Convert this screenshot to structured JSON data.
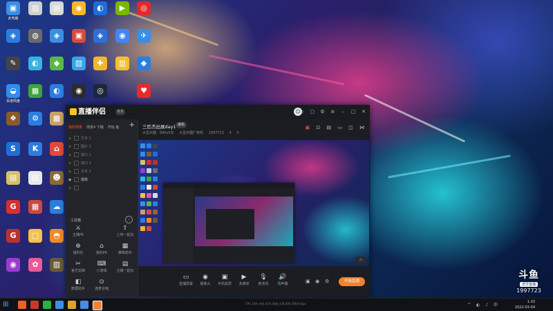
{
  "desktop": {
    "icons": [
      {
        "id": "d01",
        "label": "此电脑",
        "color": "#3a8ee6",
        "glyph": "▣"
      },
      {
        "id": "d02",
        "label": "",
        "color": "#2b7de0",
        "glyph": "◈"
      },
      {
        "id": "d03",
        "label": "",
        "color": "#444",
        "glyph": "✎"
      },
      {
        "id": "d04",
        "label": "百度网盘",
        "color": "#2f8cf0",
        "glyph": "◒"
      },
      {
        "id": "d05",
        "label": "",
        "color": "#8a5a2a",
        "glyph": "❖"
      },
      {
        "id": "d06",
        "label": "",
        "color": "#1d6fd8",
        "glyph": "S"
      },
      {
        "id": "d07",
        "label": "",
        "color": "#d8c06a",
        "glyph": "▤"
      },
      {
        "id": "d08",
        "label": "",
        "color": "#d92e2e",
        "glyph": "G"
      },
      {
        "id": "d09",
        "label": "",
        "color": "#b8322e",
        "glyph": "G"
      },
      {
        "id": "d10",
        "label": "",
        "color": "#9b3bd1",
        "glyph": "◉"
      },
      {
        "id": "d11",
        "label": "",
        "color": "#cfcfcf",
        "glyph": "▥"
      },
      {
        "id": "d12",
        "label": "",
        "color": "#6a6a6a",
        "glyph": "◍"
      },
      {
        "id": "d13",
        "label": "",
        "color": "#33b3e6",
        "glyph": "◐"
      },
      {
        "id": "d14",
        "label": "",
        "color": "#3ca33c",
        "glyph": "▦"
      },
      {
        "id": "d15",
        "label": "",
        "color": "#2d7de0",
        "glyph": "⚙"
      },
      {
        "id": "d16",
        "label": "",
        "color": "#2d7de0",
        "glyph": "K"
      },
      {
        "id": "d17",
        "label": "",
        "color": "#e8e8e8",
        "glyph": "▤"
      },
      {
        "id": "d18",
        "label": "",
        "color": "#c94a3a",
        "glyph": "▦"
      },
      {
        "id": "d19",
        "label": "",
        "color": "#f2c14e",
        "glyph": "▢"
      },
      {
        "id": "d20",
        "label": "",
        "color": "#e85a9a",
        "glyph": "✿"
      },
      {
        "id": "d21",
        "label": "",
        "color": "#d9d9d9",
        "glyph": "▤"
      },
      {
        "id": "d22",
        "label": "",
        "color": "#3a8ee6",
        "glyph": "◈"
      },
      {
        "id": "d23",
        "label": "",
        "color": "#58b948",
        "glyph": "◆"
      },
      {
        "id": "d24",
        "label": "",
        "color": "#2b7de0",
        "glyph": "◐"
      },
      {
        "id": "d25",
        "label": "",
        "color": "#c9a16a",
        "glyph": "▦"
      },
      {
        "id": "d26",
        "label": "",
        "color": "#e04a3a",
        "glyph": "⌂"
      },
      {
        "id": "d27",
        "label": "",
        "color": "#8a6a3a",
        "glyph": "☻"
      },
      {
        "id": "d28",
        "label": "",
        "color": "#2b7de0",
        "glyph": "☁"
      },
      {
        "id": "d29",
        "label": "",
        "color": "#f08a2a",
        "glyph": "◓"
      },
      {
        "id": "d30",
        "label": "",
        "color": "#6a5a3a",
        "glyph": "▥"
      },
      {
        "id": "d31",
        "label": "",
        "color": "#f2b72a",
        "glyph": "◉"
      },
      {
        "id": "d32",
        "label": "",
        "color": "#d84a3a",
        "glyph": "▣"
      },
      {
        "id": "d33",
        "label": "",
        "color": "#3aa3e6",
        "glyph": "▥"
      },
      {
        "id": "d34",
        "label": "",
        "color": "#2b2b2b",
        "glyph": "◉"
      },
      {
        "id": "d35",
        "label": "",
        "color": "#1d6fd8",
        "glyph": "◐"
      },
      {
        "id": "d36",
        "label": "",
        "color": "#2d6fd8",
        "glyph": "◈"
      },
      {
        "id": "d37",
        "label": "",
        "color": "#f2b72a",
        "glyph": "✚"
      },
      {
        "id": "d38",
        "label": "",
        "color": "#1b2838",
        "glyph": "◎"
      },
      {
        "id": "d39",
        "label": "",
        "color": "#76b900",
        "glyph": "▶"
      },
      {
        "id": "d40",
        "label": "",
        "color": "#4285f4",
        "glyph": "◉"
      },
      {
        "id": "d41",
        "label": "",
        "color": "#f2c12e",
        "glyph": "▥"
      },
      {
        "id": "d42",
        "label": "",
        "color": "#e02a2a",
        "glyph": "◎"
      },
      {
        "id": "d43",
        "label": "",
        "color": "#3a8ee6",
        "glyph": "✈"
      },
      {
        "id": "d44",
        "label": "",
        "color": "#2b7de0",
        "glyph": "◆"
      },
      {
        "id": "d45",
        "label": "",
        "color": "#e82a2a",
        "glyph": "♥"
      }
    ]
  },
  "app": {
    "logo_text": "直播伴侣",
    "version": "6.0",
    "sidebar": {
      "tabs": [
        "我的场景",
        "场景4 下播",
        "开始 备"
      ],
      "scenes": [
        {
          "label": "文本 1",
          "on": false
        },
        {
          "label": "图片 1",
          "on": false
        },
        {
          "label": "窗口 1",
          "on": false
        },
        {
          "label": "窗口 2",
          "on": false
        },
        {
          "label": "文本 2",
          "on": false
        },
        {
          "label": "摄像",
          "on": true
        },
        {
          "label": "",
          "on": false
        }
      ],
      "toolbox_title": "工具箱",
      "tools": [
        {
          "icon": "⚔",
          "label": "主播PK",
          "name": "pk"
        },
        {
          "icon": "",
          "label": "",
          "name": "blank"
        },
        {
          "icon": "⇪",
          "label": "上传一起玩",
          "name": "upload"
        },
        {
          "icon": "⊕",
          "label": "福利社",
          "name": "welfare"
        },
        {
          "icon": "⌂",
          "label": "我的PK",
          "name": "my-pk"
        },
        {
          "icon": "▦",
          "label": "推荐助手",
          "name": "helper"
        },
        {
          "icon": "✂",
          "label": "官方剪辑",
          "name": "clip"
        },
        {
          "icon": "⌨",
          "label": "小游戏",
          "name": "minigame"
        },
        {
          "icon": "▤",
          "label": "主播一起玩",
          "name": "play-together"
        },
        {
          "icon": "◧",
          "label": "数据助手",
          "name": "data-helper"
        },
        {
          "icon": "⊙",
          "label": "连麦合唱",
          "name": "chorus"
        }
      ]
    },
    "stream": {
      "title": "三匹杰出展day1",
      "tag": "编辑",
      "meta": [
        "大显示器 · 990x5天",
        "大显示器广电机",
        "1997723",
        "4",
        "0"
      ]
    },
    "bottom_buttons": [
      {
        "icon": "▭",
        "label": "直播屏幕",
        "name": "screen-capture"
      },
      {
        "icon": "◉",
        "label": "摄像头",
        "name": "camera"
      },
      {
        "icon": "▣",
        "label": "手机投屏",
        "name": "phone-cast"
      },
      {
        "icon": "▶",
        "label": "多媒体",
        "name": "media"
      },
      {
        "icon": "🎙",
        "label": "麦克风",
        "name": "mic"
      },
      {
        "icon": "🔊",
        "label": "扬声器",
        "name": "speaker"
      }
    ],
    "go_live_label": "开始直播"
  },
  "taskbar": {
    "time": "1:33",
    "date": "2022-03-04",
    "status_text": "CPU 18% 内存 42%  网络 正常  码率 2800 kbps"
  },
  "watermark": {
    "brand": "斗鱼",
    "sub": "虎牙直播",
    "room_id": "1997723"
  },
  "colors": {
    "accent_orange": "#f5812e",
    "accent_red": "#f5502e",
    "app_bg": "#1e1f24"
  }
}
